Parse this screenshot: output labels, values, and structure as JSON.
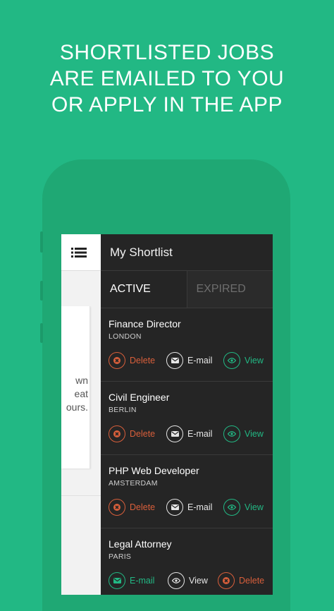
{
  "headline": {
    "line1": "SHORTLISTED JOBS",
    "line2": "ARE EMAILED TO YOU",
    "line3": "OR APPLY IN THE APP"
  },
  "drawer": {
    "title": "My Shortlist",
    "tabs": [
      {
        "label": "ACTIVE",
        "active": true
      },
      {
        "label": "EXPIRED",
        "active": false
      }
    ]
  },
  "behind_card": {
    "line1": "wn",
    "line2": "eat",
    "line3": "ours."
  },
  "jobs": [
    {
      "title": "Finance Director",
      "city": "LONDON",
      "actions": [
        "Delete",
        "E-mail",
        "View"
      ]
    },
    {
      "title": "Civil Engineer",
      "city": "BERLIN",
      "actions": [
        "Delete",
        "E-mail",
        "View"
      ]
    },
    {
      "title": "PHP Web Developer",
      "city": "AMSTERDAM",
      "actions": [
        "Delete",
        "E-mail",
        "View"
      ]
    },
    {
      "title": "Legal Attorney",
      "city": "PARIS",
      "actions": [
        "E-mail",
        "View",
        "Delete"
      ]
    }
  ],
  "colors": {
    "background": "#22b884",
    "phone": "#1fa874",
    "drawer": "#252525",
    "delete": "#d95f3b",
    "view": "#22b884"
  }
}
